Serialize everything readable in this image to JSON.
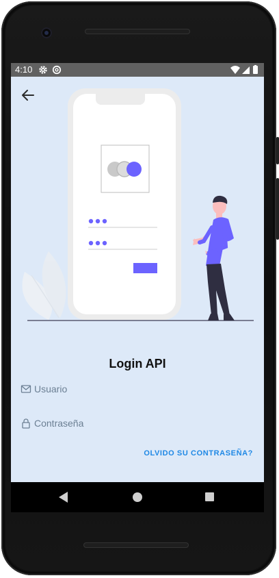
{
  "status_bar": {
    "time": "4:10",
    "left_icons": [
      "gear-icon",
      "at-sign-icon"
    ],
    "right_icons": [
      "wifi-icon",
      "signal-icon",
      "battery-icon"
    ]
  },
  "app_bar": {
    "back_icon": "arrow-left-icon"
  },
  "illustration": {
    "name": "login-illustration",
    "accent_color": "#6c63ff"
  },
  "login": {
    "title": "Login API",
    "username": {
      "placeholder": "Usuario",
      "value": "",
      "icon": "mail-icon"
    },
    "password": {
      "placeholder": "Contraseña",
      "value": "",
      "icon": "lock-icon"
    },
    "forgot_label": "OLVIDO SU CONTRASEÑA?"
  },
  "nav_bar": {
    "icons": [
      "nav-back-icon",
      "nav-home-icon",
      "nav-recents-icon"
    ]
  },
  "colors": {
    "screen_background": "#dde9f8",
    "accent": "#6c63ff",
    "link": "#1e88e5",
    "status_bar": "#616161"
  }
}
